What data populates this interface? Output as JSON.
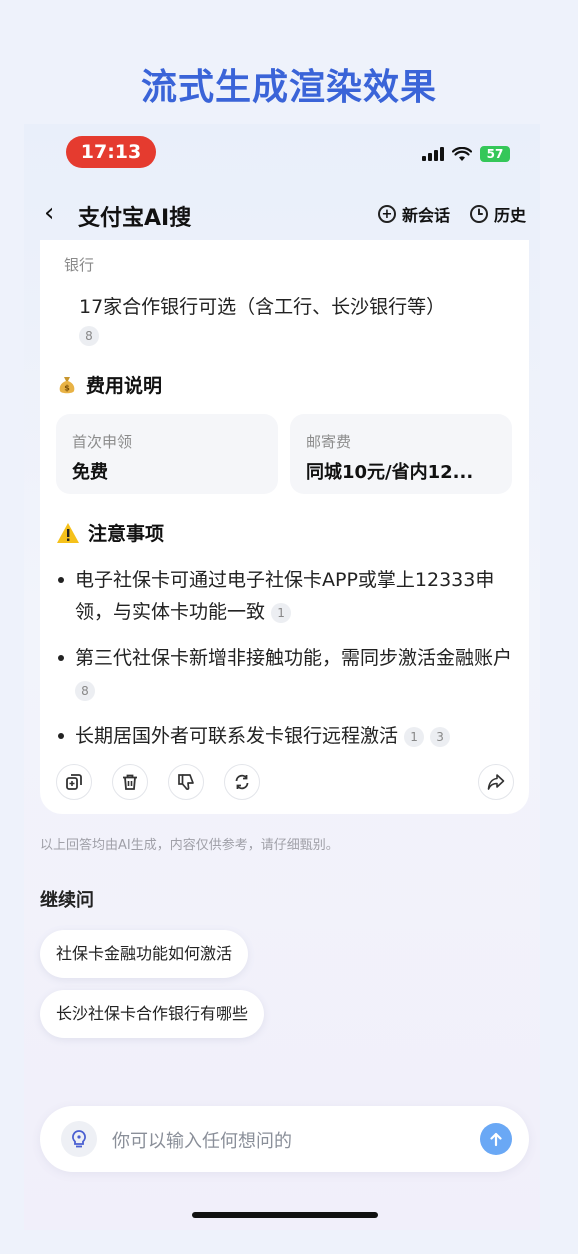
{
  "headline": "流式生成渲染效果",
  "status_bar": {
    "time": "17:13",
    "battery": "57"
  },
  "nav": {
    "back_glyph": "‹",
    "title": "支付宝AI搜",
    "new_chat": "新会话",
    "history": "历史"
  },
  "answer": {
    "bank_label": "银行",
    "bank_value": "17家合作银行可选（含工行、长沙银行等）",
    "bank_ref": "8",
    "fees_title": "费用说明",
    "fees": [
      {
        "label": "首次申领",
        "value": "免费"
      },
      {
        "label": "邮寄费",
        "value": "同城10元/省内12..."
      }
    ],
    "notes_title": "注意事项",
    "notes": [
      {
        "text": "电子社保卡可通过电子社保卡APP或掌上12333申领，与实体卡功能一致",
        "refs": [
          "1"
        ]
      },
      {
        "text": "第三代社保卡新增非接触功能，需同步激活金融账户",
        "refs": [
          "8"
        ]
      },
      {
        "text": "长期居国外者可联系发卡银行远程激活",
        "refs": [
          "1",
          "3"
        ]
      }
    ]
  },
  "disclaimer": "以上回答均由AI生成，内容仅供参考，请仔细甄别。",
  "continue": {
    "label": "继续问",
    "suggestions": [
      "社保卡金融功能如何激活",
      "长沙社保卡合作银行有哪些"
    ]
  },
  "input": {
    "placeholder": "你可以输入任何想问的"
  },
  "icons": {
    "money": "money-bag-icon",
    "warning": "warning-icon",
    "copy": "copy-icon",
    "delete": "trash-icon",
    "dislike": "thumbs-down-icon",
    "regenerate": "refresh-icon",
    "share": "share-icon",
    "bulb": "lightbulb-icon",
    "send": "send-arrow-icon"
  },
  "colors": {
    "headline": "#3a64d8",
    "time_pill": "#e53b2f",
    "battery": "#35c759",
    "send": "#6aa8f5"
  }
}
